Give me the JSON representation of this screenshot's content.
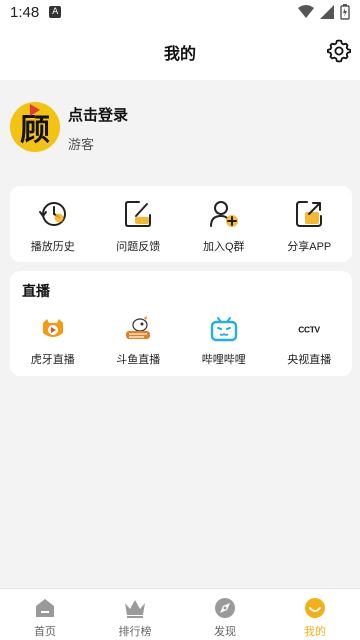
{
  "status_bar": {
    "time": "1:48",
    "notification_glyph": "A"
  },
  "header": {
    "title": "我的",
    "settings_icon": "gear-icon"
  },
  "profile": {
    "login_text": "点击登录",
    "guest_text": "游客",
    "avatar_glyph": "顾"
  },
  "tools": {
    "items": [
      {
        "label": "播放历史",
        "icon": "history-icon"
      },
      {
        "label": "问题反馈",
        "icon": "feedback-icon"
      },
      {
        "label": "加入Q群",
        "icon": "add-user-icon"
      },
      {
        "label": "分享APP",
        "icon": "share-icon"
      }
    ]
  },
  "live": {
    "title": "直播",
    "items": [
      {
        "label": "虎牙直播",
        "icon": "huya-icon"
      },
      {
        "label": "斗鱼直播",
        "icon": "douyu-icon"
      },
      {
        "label": "哔哩哔哩",
        "icon": "bilibili-icon"
      },
      {
        "label": "央视直播",
        "icon": "cctv-icon",
        "logo_text": "CCTV"
      }
    ]
  },
  "bottom_nav": {
    "items": [
      {
        "label": "首页",
        "icon": "home-icon"
      },
      {
        "label": "排行榜",
        "icon": "crown-icon"
      },
      {
        "label": "发现",
        "icon": "discover-icon"
      },
      {
        "label": "我的",
        "icon": "smile-icon",
        "active": true
      }
    ]
  },
  "colors": {
    "accent": "#f3b01b",
    "avatar_bg": "#f3c313",
    "page_bg": "#f3f3f3"
  }
}
